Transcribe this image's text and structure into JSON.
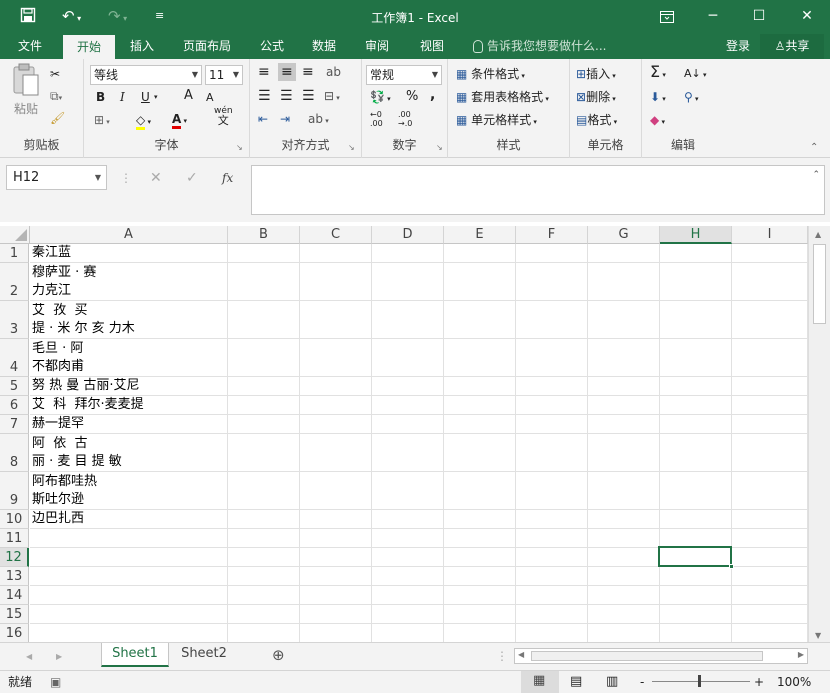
{
  "window": {
    "title": "工作簿1 - Excel",
    "restore_icon": "ribbon-display-icon",
    "min": "─",
    "max": "☐",
    "close": "✕"
  },
  "quick_access": {
    "save": "save-icon",
    "undo": "undo-icon",
    "redo": "redo-icon",
    "customize": "customize-icon"
  },
  "tabs": [
    "文件",
    "开始",
    "插入",
    "页面布局",
    "公式",
    "数据",
    "审阅",
    "视图"
  ],
  "active_tab": "开始",
  "tell_me": "告诉我您想要做什么...",
  "account": {
    "login": "登录",
    "share": "共享"
  },
  "ribbon": {
    "clipboard": {
      "label": "剪贴板",
      "paste": "粘贴"
    },
    "font": {
      "label": "字体",
      "name": "等线",
      "size": "11",
      "bold": "B",
      "italic": "I",
      "underline": "U",
      "grow": "A",
      "shrink": "A",
      "color_letter": "A",
      "phonetic": "wén",
      "phonetic2": "文"
    },
    "alignment": {
      "label": "对齐方式"
    },
    "number": {
      "label": "数字",
      "format": "常规",
      "percent": "%",
      "comma": ","
    },
    "styles": {
      "label": "样式",
      "conditional": "条件格式",
      "table": "套用表格格式",
      "cell": "单元格样式"
    },
    "cells": {
      "label": "单元格",
      "insert": "插入",
      "delete": "删除",
      "format": "格式"
    },
    "editing": {
      "label": "编辑",
      "sum": "Σ"
    }
  },
  "formula_bar": {
    "name_box": "H12",
    "cancel": "✕",
    "enter": "✓",
    "fx": "fx",
    "value": ""
  },
  "columns": [
    "A",
    "B",
    "C",
    "D",
    "E",
    "F",
    "G",
    "H",
    "I"
  ],
  "selected_column": "H",
  "rows": [
    "1",
    "2",
    "3",
    "4",
    "5",
    "6",
    "7",
    "8",
    "9",
    "10",
    "11",
    "12",
    "13",
    "14",
    "15",
    "16"
  ],
  "selected_row": "12",
  "cells": [
    {
      "row": "1",
      "lines": [
        "秦江蓝"
      ]
    },
    {
      "row": "2",
      "lines": [
        "穆萨亚 · 赛",
        "力克江"
      ]
    },
    {
      "row": "3",
      "lines": [
        "艾  孜  买",
        "提 · 米 尔 亥 力木"
      ]
    },
    {
      "row": "4",
      "lines": [
        "毛旦 · 阿",
        "不都肉甫"
      ]
    },
    {
      "row": "5",
      "lines": [
        "努 热 曼 古丽·艾尼"
      ]
    },
    {
      "row": "6",
      "lines": [
        "艾  科  拜尔·麦麦提"
      ]
    },
    {
      "row": "7",
      "lines": [
        "赫一提罕"
      ]
    },
    {
      "row": "8",
      "lines": [
        "阿  依  古",
        "丽 · 麦 目 提 敏"
      ]
    },
    {
      "row": "9",
      "lines": [
        "阿布都哇热",
        "斯吐尔逊"
      ]
    },
    {
      "row": "10",
      "lines": [
        "边巴扎西"
      ]
    }
  ],
  "sheets": [
    "Sheet1",
    "Sheet2"
  ],
  "active_sheet": "Sheet1",
  "status": {
    "ready": "就绪",
    "zoom": "100%",
    "minus": "-",
    "plus": "+"
  },
  "colors": {
    "accent": "#217346",
    "grid": "#e1e1e1",
    "header": "#f3f3f3"
  }
}
